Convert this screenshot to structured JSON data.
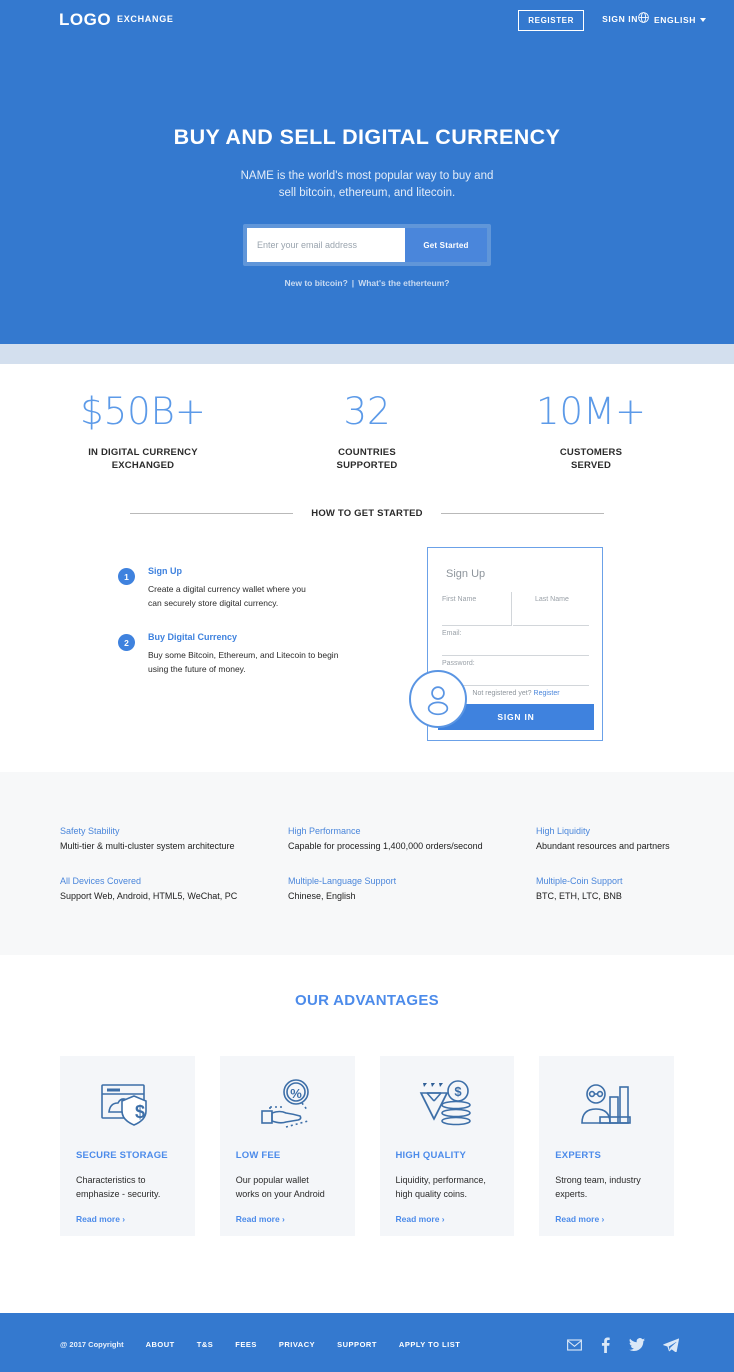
{
  "nav": {
    "logo": "LOGO",
    "exchange": "EXCHANGE",
    "register": "REGISTER",
    "signin": "SIGN IN",
    "language": "ENGLISH"
  },
  "hero": {
    "title": "BUY AND SELL DIGITAL CURRENCY",
    "subtitle_line1": "NAME is the world's most popular way to buy and",
    "subtitle_line2": "sell bitcoin, ethereum, and litecoin.",
    "email_placeholder": "Enter your email address",
    "email_value": "",
    "cta": "Get Started",
    "link_new": "New to bitcoin?",
    "link_sep": "|",
    "link_eth": "What's the etherteum?"
  },
  "stats": [
    {
      "value": "$50B+",
      "label_line1": "IN DIGITAL CURRENCY",
      "label_line2": "EXCHANGED"
    },
    {
      "value": "32",
      "label_line1": "COUNTRIES",
      "label_line2": "SUPPORTED"
    },
    {
      "value": "10M+",
      "label_line1": "CUSTOMERS",
      "label_line2": "SERVED"
    }
  ],
  "howto": {
    "heading": "HOW TO GET STARTED"
  },
  "steps": [
    {
      "number": "1",
      "title": "Sign Up",
      "desc_line1": "Create a digital currency wallet where you",
      "desc_line2": "can securely store digital currency."
    },
    {
      "number": "2",
      "title": "Buy Digital Currency",
      "desc_line1": "Buy some Bitcoin, Ethereum, and Litecoin to begin",
      "desc_line2": "using the future of money."
    }
  ],
  "form": {
    "title": "Sign Up",
    "first_name": "First Name",
    "last_name": "Last Name",
    "email": "Email:",
    "password": "Password:",
    "note": "Not registered yet?",
    "note_link": "Register",
    "submit": "SIGN IN"
  },
  "features": [
    {
      "title": "Safety Stability",
      "desc": "Multi-tier & multi-cluster system architecture"
    },
    {
      "title": "High Performance",
      "desc": "Capable for processing 1,400,000 orders/second"
    },
    {
      "title": "High Liquidity",
      "desc": "Abundant resources and partners"
    },
    {
      "title": "All Devices Covered",
      "desc": "Support Web, Android, HTML5, WeChat, PC"
    },
    {
      "title": "Multiple-Language Support",
      "desc": "Chinese, English"
    },
    {
      "title": "Multiple-Coin Support",
      "desc": "BTC, ETH, LTC, BNB"
    }
  ],
  "advantages": {
    "heading": "OUR ADVANTAGES",
    "cards": [
      {
        "icon": "browser-shield-dollar-icon",
        "name": "SECURE STORAGE",
        "desc_line1": "Characteristics to",
        "desc_line2": "emphasize - security.",
        "more": "Read more ›"
      },
      {
        "icon": "hand-percent-coin-icon",
        "name": "LOW FEE",
        "desc_line1": "Our popular wallet",
        "desc_line2": "works on your Android",
        "more": "Read more ›"
      },
      {
        "icon": "diamond-coins-dollar-icon",
        "name": "HIGH QUALITY",
        "desc_line1": "Liquidity, performance,",
        "desc_line2": "high quality coins.",
        "more": "Read more ›"
      },
      {
        "icon": "person-bar-chart-icon",
        "name": "EXPERTS",
        "desc_line1": "Strong team, industry",
        "desc_line2": "experts.",
        "more": "Read more ›"
      }
    ]
  },
  "footer": {
    "copyright": "@ 2017 Copyright",
    "links": [
      "ABOUT",
      "T&S",
      "FEES",
      "PRIVACY",
      "SUPPORT",
      "APPLY TO LIST"
    ],
    "social": [
      "email-icon",
      "facebook-icon",
      "twitter-icon",
      "telegram-icon"
    ]
  },
  "colors": {
    "brand_blue": "#3479cf",
    "accent_blue": "#4a86db",
    "light_band": "#d3dfee",
    "gray_section": "#f7f8f9",
    "card_gray": "#f4f6f9"
  }
}
